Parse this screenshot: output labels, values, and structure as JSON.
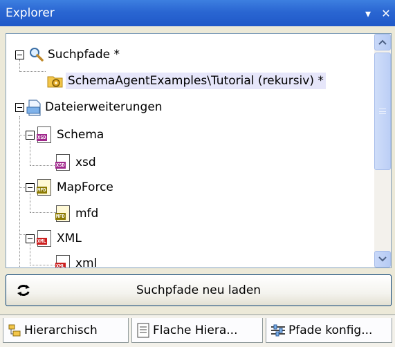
{
  "window": {
    "title": "Explorer",
    "menu_glyph": "▾",
    "close_glyph": "✕"
  },
  "tree": {
    "nodes": [
      {
        "label": "Suchpfade *",
        "icon": "search-icon"
      },
      {
        "label": "SchemaAgentExamples\\Tutorial (rekursiv) *",
        "icon": "folder-gear-icon",
        "selected": true
      },
      {
        "label": "Dateierweiterungen",
        "icon": "file-extensions-icon"
      },
      {
        "label": "Schema",
        "icon": "xsd-file-icon",
        "badge": "XSD"
      },
      {
        "label": "xsd",
        "icon": "xsd-file-icon",
        "badge": "XSD"
      },
      {
        "label": "MapForce",
        "icon": "mfd-file-icon",
        "badge": "MFD"
      },
      {
        "label": "mfd",
        "icon": "mfd-file-icon",
        "badge": "MFD"
      },
      {
        "label": "XML",
        "icon": "xml-file-icon",
        "badge": "XML"
      },
      {
        "label": "xml",
        "icon": "xml-file-icon",
        "badge": "XML"
      }
    ]
  },
  "reload_button": {
    "label": "Suchpfade neu laden",
    "icon": "reload-icon"
  },
  "tabs": [
    {
      "label": "Hierarchisch",
      "icon": "hierarchy-icon"
    },
    {
      "label": "Flache Hiera...",
      "icon": "flat-list-icon"
    },
    {
      "label": "Pfade konfig...",
      "icon": "configure-paths-icon"
    }
  ],
  "colors": {
    "titlebar": "#2a66d2",
    "selection": "#e6e6fa",
    "xsd_badge": "#a0288c",
    "mfd_badge": "#8c7a00",
    "xml_badge": "#cc1f1f"
  }
}
